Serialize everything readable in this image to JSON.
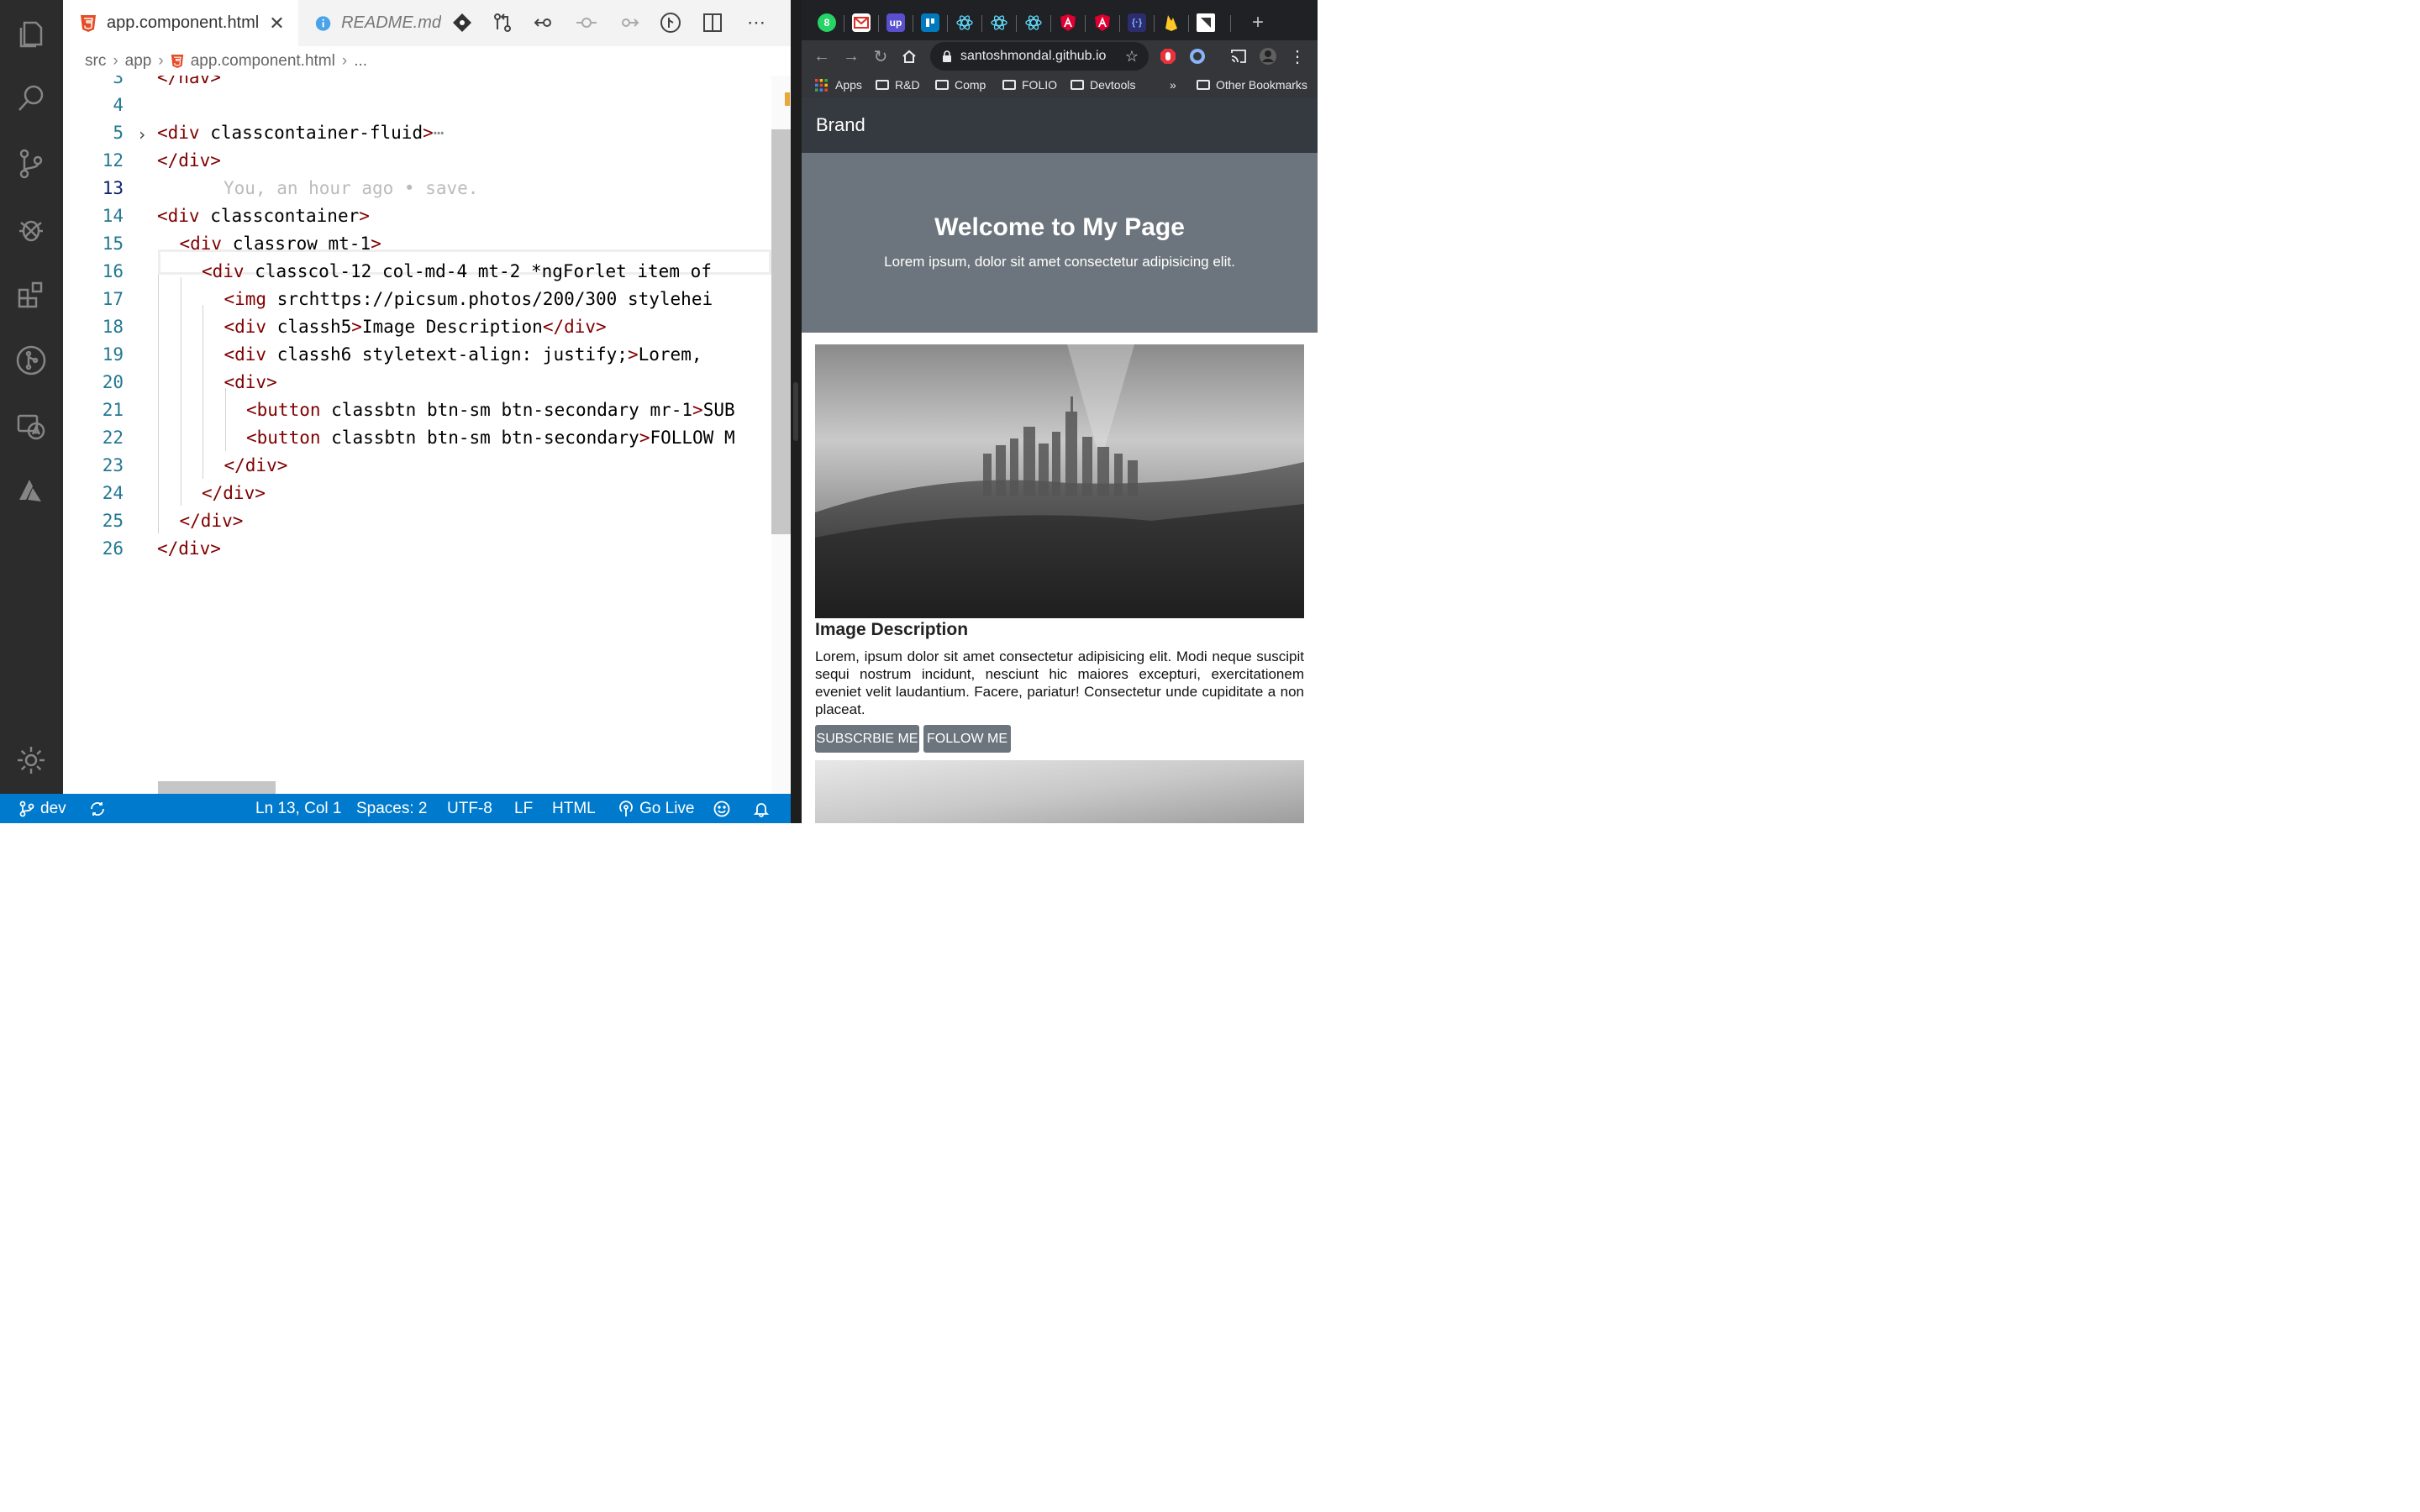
{
  "editor": {
    "tabs": [
      {
        "label": "app.component.html",
        "active": true
      },
      {
        "label": "README.md",
        "active": false
      }
    ],
    "breadcrumb": [
      "src",
      "app",
      "app.component.html",
      "..."
    ],
    "code_lines": [
      {
        "n": "3",
        "text": "</nav>"
      },
      {
        "n": "4",
        "text": ""
      },
      {
        "n": "5",
        "text": "<div class=\"container-fluid\">⋯"
      },
      {
        "n": "12",
        "text": "</div>"
      },
      {
        "n": "13",
        "text": "You, an hour ago • save."
      },
      {
        "n": "14",
        "text": "<div class=\"container\">"
      },
      {
        "n": "15",
        "text": "<div class=\"row mt-1\">"
      },
      {
        "n": "16",
        "text": "<div class=\"col-12 col-md-4 mt-2\" *ngFor=\"let item of"
      },
      {
        "n": "17",
        "text": "<img src=\"https://picsum.photos/200/300\" style=\"hei"
      },
      {
        "n": "18",
        "text": "<div class=\"h5\">Image Description</div>"
      },
      {
        "n": "19",
        "text": "<div class=\"h6\" style=\"text-align: justify;\">Lorem,"
      },
      {
        "n": "20",
        "text": "<div>"
      },
      {
        "n": "21",
        "text": "<button class=\"btn btn-sm btn-secondary mr-1\">SUB"
      },
      {
        "n": "22",
        "text": "<button class=\"btn btn-sm btn-secondary\">FOLLOW M"
      },
      {
        "n": "23",
        "text": "</div>"
      },
      {
        "n": "24",
        "text": "</div>"
      },
      {
        "n": "25",
        "text": "</div>"
      },
      {
        "n": "26",
        "text": "</div>"
      }
    ],
    "status": {
      "branch": "dev",
      "position": "Ln 13, Col 1",
      "spaces": "Spaces: 2",
      "encoding": "UTF-8",
      "eol": "LF",
      "language": "HTML",
      "go_live": "Go Live"
    }
  },
  "browser": {
    "url": "santoshmondal.github.io",
    "tab_badge": "8",
    "tab_badge2": "up",
    "bookmarks": [
      "Apps",
      "R&D",
      "Comp",
      "FOLIO",
      "Devtools",
      "»",
      "Other Bookmarks"
    ],
    "page": {
      "brand": "Brand",
      "hero_title": "Welcome to My Page",
      "hero_subtitle": "Lorem ipsum, dolor sit amet consectetur adipisicing elit.",
      "card_title": "Image Description",
      "card_text": "Lorem, ipsum dolor sit amet consectetur adipisicing elit. Modi neque suscipit sequi nostrum incidunt, nesciunt hic maiores excepturi, exercitationem eveniet velit laudantium. Facere, pariatur! Consectetur unde cupiditate a non placeat.",
      "subscribe_label": "SUBSCRBIE ME",
      "follow_label": "FOLLOW ME"
    }
  },
  "colors": {
    "status_bar": "#007acc",
    "activity_bar": "#2c2c2c",
    "navbar": "#343a40",
    "hero": "#6c757d"
  }
}
